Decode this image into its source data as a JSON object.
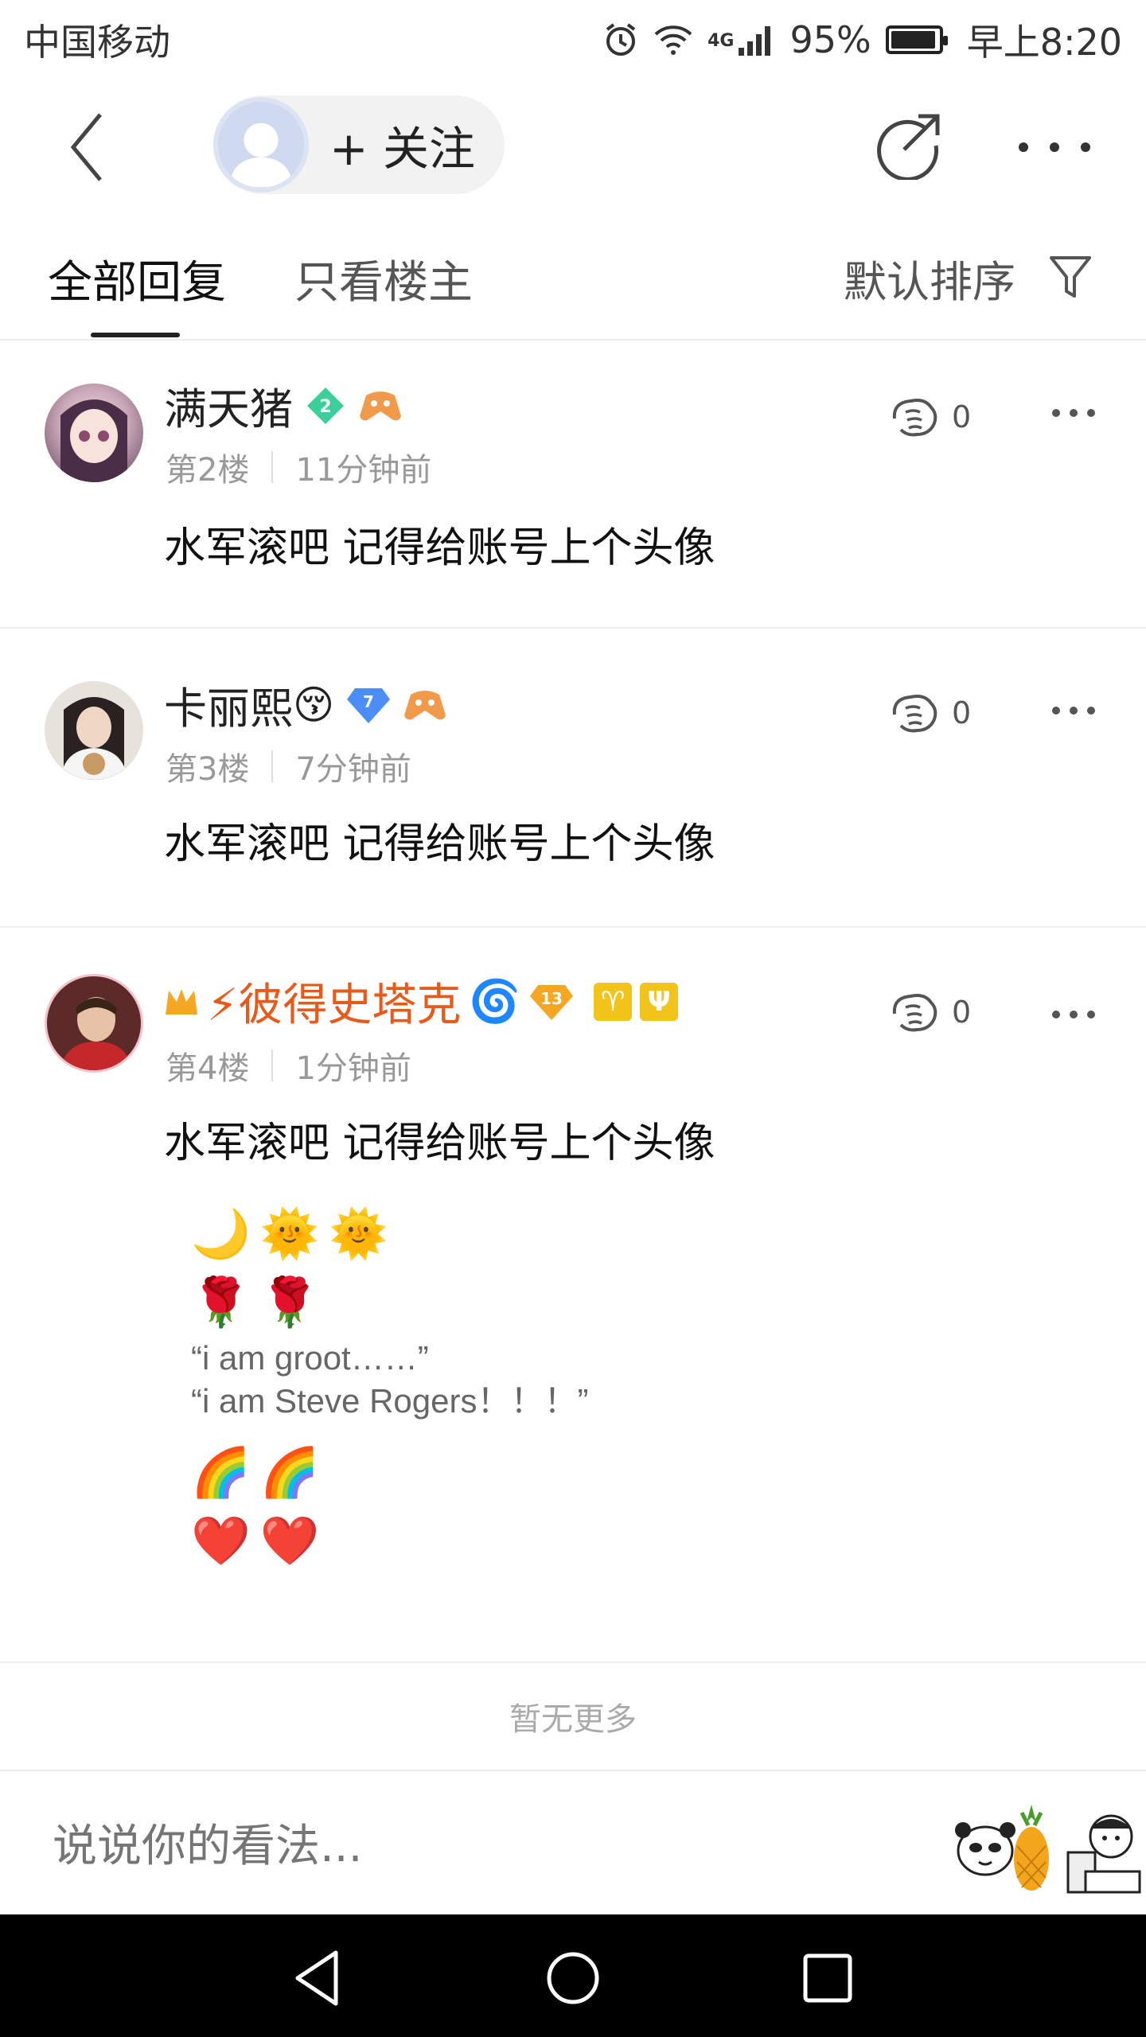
{
  "status_bar": {
    "carrier": "中国移动",
    "network": "4G",
    "battery": "95%",
    "battery_level": 0.95,
    "time": "早上8:20"
  },
  "header": {
    "follow_label": "+ 关注"
  },
  "tabs": {
    "all": "全部回复",
    "owner": "只看楼主",
    "sort": "默认排序"
  },
  "comments": [
    {
      "username": "满天猪",
      "level": "2",
      "floor": "第2楼",
      "time": "11分钟前",
      "likes": "0",
      "text": "水军滚吧 记得给账号上个头像"
    },
    {
      "username": "卡丽熙",
      "name_emoji": "😚",
      "level": "7",
      "floor": "第3楼",
      "time": "7分钟前",
      "likes": "0",
      "text": "水军滚吧 记得给账号上个头像"
    },
    {
      "username": "⚡彼得史塔克",
      "name_emoji": "🌀",
      "level": "13",
      "zodiac1": "♈",
      "zodiac2": "Ψ",
      "floor": "第4楼",
      "time": "1分钟前",
      "likes": "0",
      "text": "水军滚吧 记得给账号上个头像",
      "emoji_row1": "🌙🌞🌞",
      "emoji_row2": "🌹🌹",
      "quote1": "“i am groot……”",
      "quote2": "“i am Steve Rogers！！！”",
      "emoji_row3": "🌈🌈",
      "emoji_row4": "❤️❤️"
    }
  ],
  "footer": {
    "no_more": "暂无更多"
  },
  "input": {
    "placeholder": "说说你的看法..."
  },
  "colors": {
    "highlight_name": "#e85a1b",
    "meta": "#999999",
    "divider": "#ececec"
  }
}
